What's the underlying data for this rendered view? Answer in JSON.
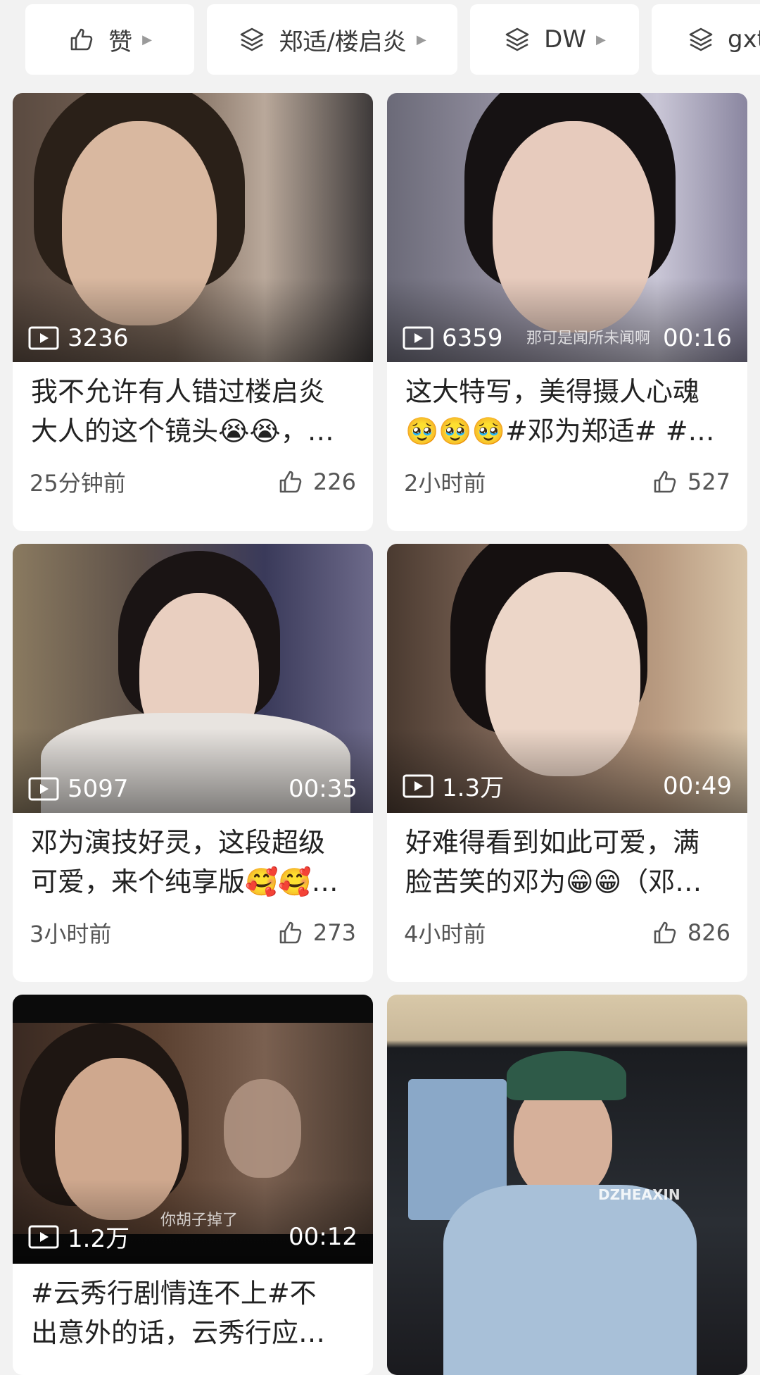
{
  "chips": [
    {
      "icon": "thumbs-up-icon",
      "label": "赞"
    },
    {
      "icon": "layers-icon",
      "label": "郑适/楼启炎"
    },
    {
      "icon": "layers-icon",
      "label": "DW"
    },
    {
      "icon": "layers-icon",
      "label": "gxt"
    }
  ],
  "cards": [
    {
      "views": "3236",
      "duration": "",
      "overlay": "",
      "title_line1": "我不允许有人错过楼启炎",
      "title_line2": "大人的这个镜头😭😭，…",
      "time": "25分钟前",
      "likes": "226"
    },
    {
      "views": "6359",
      "duration": "00:16",
      "overlay": "那可是闻所未闻啊",
      "title_line1": "这大特写，美得摄人心魂",
      "title_line2": "🥹🥹🥹#邓为郑适# #…",
      "time": "2小时前",
      "likes": "527"
    },
    {
      "views": "5097",
      "duration": "00:35",
      "overlay": "",
      "title_line1": "邓为演技好灵，这段超级",
      "title_line2": "可爱，来个纯享版🥰🥰…",
      "time": "3小时前",
      "likes": "273"
    },
    {
      "views": "1.3万",
      "duration": "00:49",
      "overlay": "",
      "title_line1": "好难得看到如此可爱，满",
      "title_line2": "脸苦笑的邓为😁😁（邓…",
      "time": "4小时前",
      "likes": "826"
    },
    {
      "views": "1.2万",
      "duration": "00:12",
      "overlay": "你胡子掉了",
      "title_line1": "#云秀行剧情连不上#不",
      "title_line2": "出意外的话，云秀行应…",
      "time": "",
      "likes": ""
    },
    {
      "views": "",
      "duration": "",
      "overlay": "DZHEAXIN",
      "title_line1": "",
      "title_line2": "",
      "time": "",
      "likes": ""
    }
  ]
}
